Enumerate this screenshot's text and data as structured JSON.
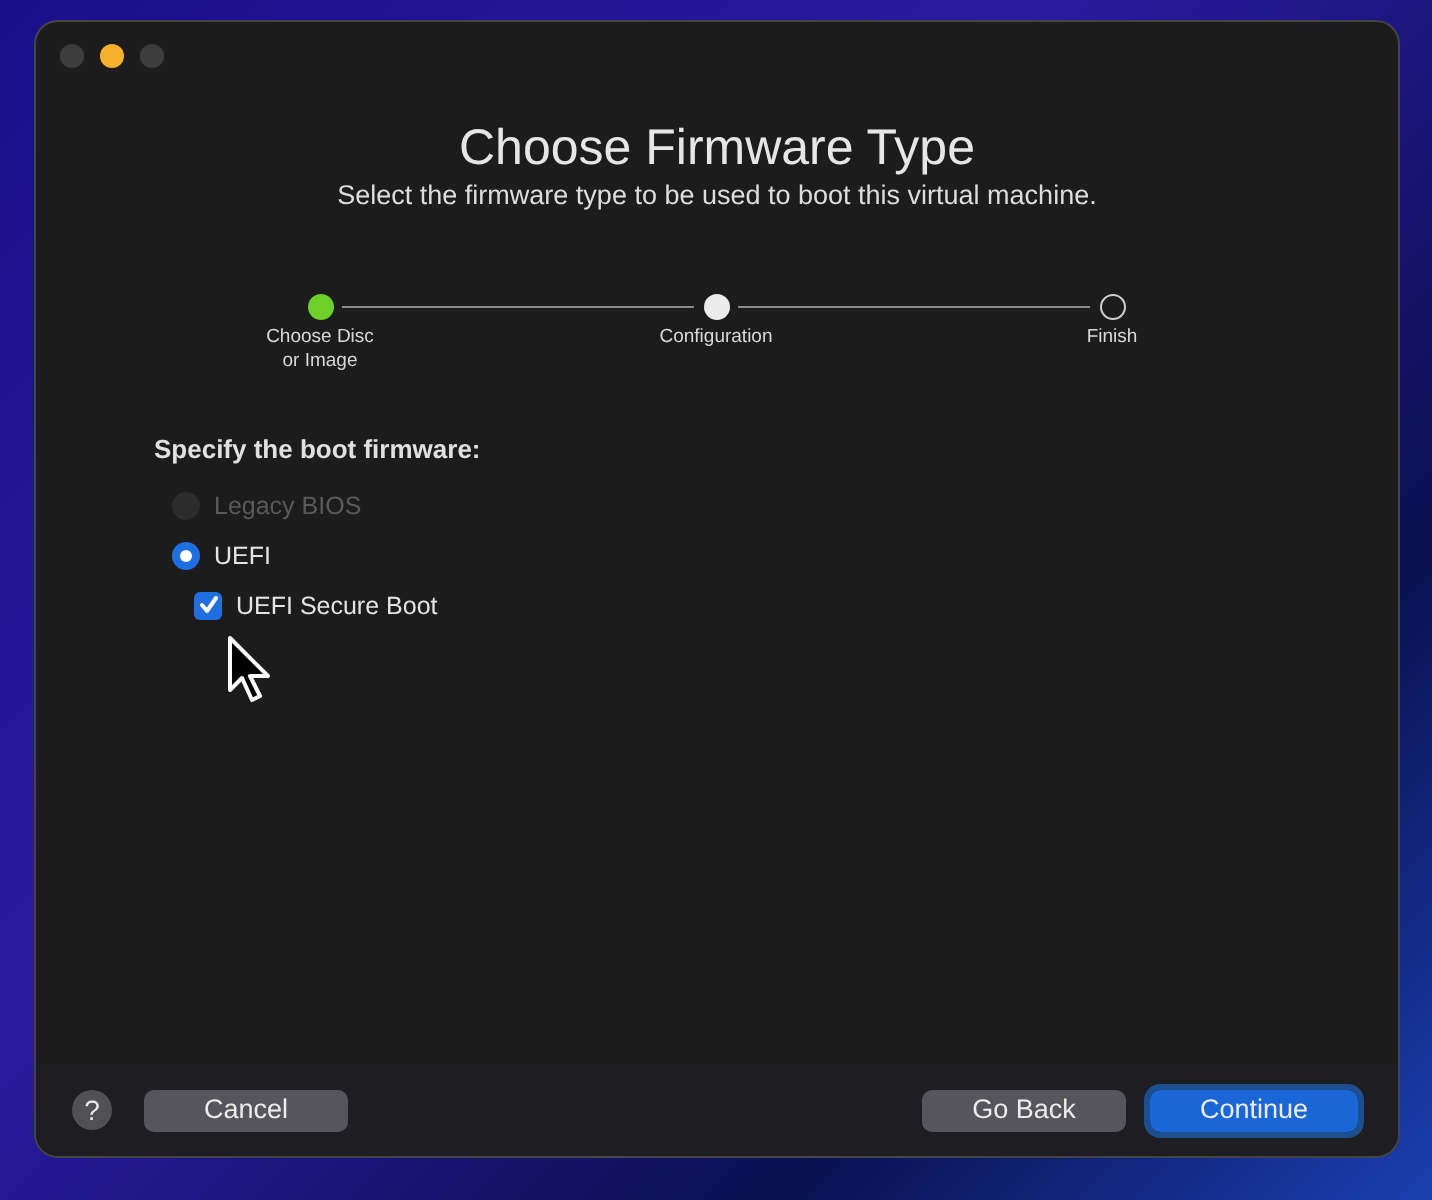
{
  "window": {
    "title": "Choose Firmware Type",
    "subtitle": "Select the firmware type to be used to boot this virtual machine."
  },
  "steps": [
    {
      "label": "Choose Disc",
      "label_line2": "or Image",
      "completed": true,
      "selected": false
    },
    {
      "label": "Configuration",
      "completed": false,
      "selected": true
    },
    {
      "label": "Finish",
      "completed": false,
      "selected": false
    }
  ],
  "section": {
    "heading": "Specify the boot firmware:"
  },
  "options": [
    {
      "kind": "radio",
      "label": "Legacy BIOS",
      "checked": false,
      "disabled": true
    },
    {
      "kind": "radio",
      "label": "UEFI",
      "checked": true,
      "disabled": false,
      "children": [
        {
          "kind": "checkbox",
          "label": "UEFI Secure Boot",
          "checked": true,
          "disabled": false
        }
      ]
    }
  ],
  "footer": {
    "help": "?",
    "buttons": [
      {
        "label": "Cancel",
        "kind": "secondary"
      },
      {
        "label": "Go Back",
        "kind": "secondary"
      },
      {
        "label": "Continue",
        "kind": "primary"
      }
    ]
  }
}
